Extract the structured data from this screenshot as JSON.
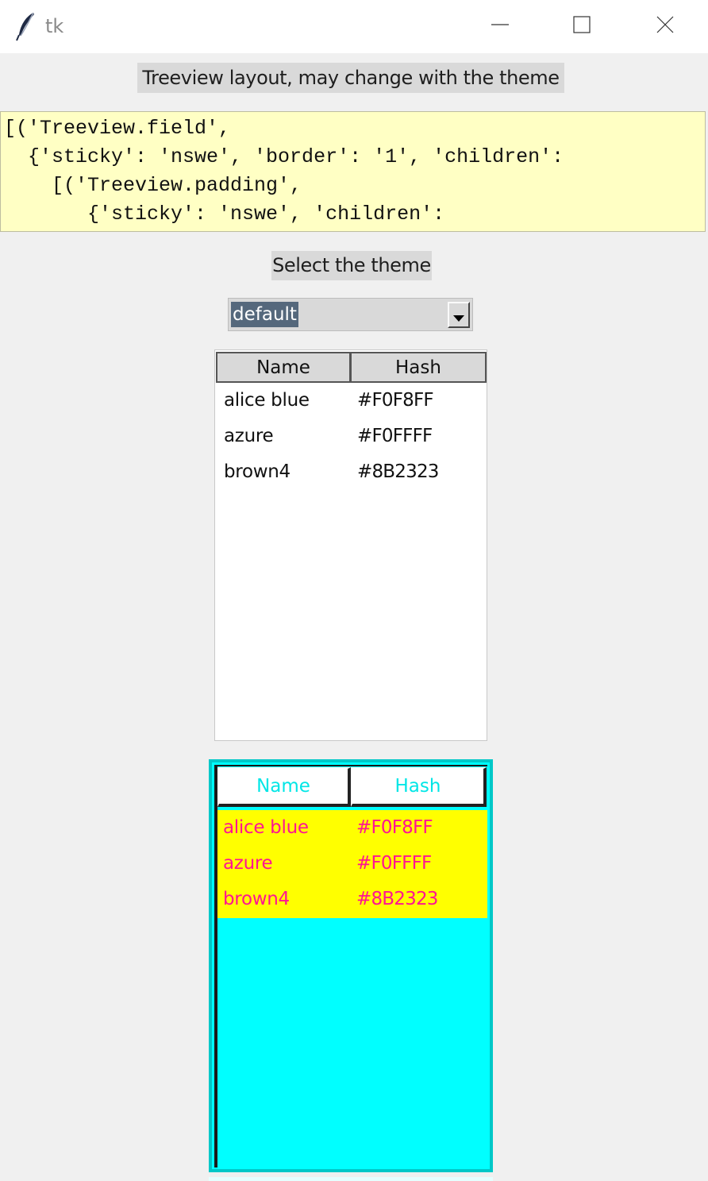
{
  "window": {
    "title": "tk"
  },
  "info_label": "Treeview layout, may change with the theme",
  "layout_text": "[('Treeview.field',\n  {'sticky': 'nswe', 'border': '1', 'children':\n    [('Treeview.padding',\n       {'sticky': 'nswe', 'children':",
  "theme_label": "Select the theme",
  "theme_combo": {
    "value": "default"
  },
  "tree_default": {
    "columns": [
      "Name",
      "Hash"
    ],
    "rows": [
      {
        "name": "alice blue",
        "hash": "#F0F8FF"
      },
      {
        "name": "azure",
        "hash": "#F0FFFF"
      },
      {
        "name": "brown4",
        "hash": "#8B2323"
      }
    ]
  },
  "tree_styled": {
    "columns": [
      "Name",
      "Hash"
    ],
    "rows": [
      {
        "name": "alice blue",
        "hash": "#F0F8FF"
      },
      {
        "name": "azure",
        "hash": "#F0FFFF"
      },
      {
        "name": "brown4",
        "hash": "#8B2323"
      }
    ],
    "colors": {
      "background": "#00FFFF",
      "row_background": "#FFFF00",
      "row_text": "#FF1493",
      "header_text": "#00E6E6"
    }
  },
  "icons": [
    "feather-icon",
    "minimize-icon",
    "maximize-icon",
    "close-icon",
    "dropdown-arrow-icon"
  ]
}
